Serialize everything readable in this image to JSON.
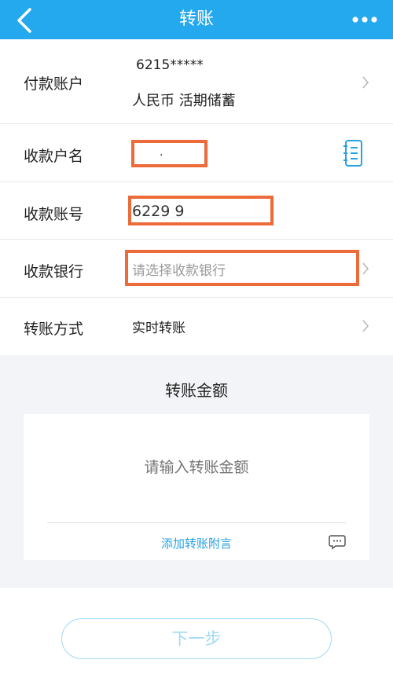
{
  "header": {
    "title": "转账",
    "back_icon": "back-chevron-icon",
    "more_icon": "more-dots-icon",
    "bg_color": "#24a8ee"
  },
  "form": {
    "payer": {
      "label": "付款账户",
      "account_number": "6215*****",
      "account_type": "人民币 活期储蓄"
    },
    "payee_name": {
      "label": "收款户名",
      "value": ".",
      "contacts_icon": "address-book-icon"
    },
    "payee_account": {
      "label": "收款账号",
      "value": "6229 9"
    },
    "payee_bank": {
      "label": "收款银行",
      "placeholder": "请选择收款银行"
    },
    "transfer_method": {
      "label": "转账方式",
      "value": "实时转账"
    }
  },
  "amount": {
    "title": "转账金额",
    "placeholder": "请输入转账金额",
    "add_note": "添加转账附言",
    "note_icon": "message-bubble-icon"
  },
  "footer": {
    "next_label": "下一步"
  },
  "colors": {
    "highlight": "#ec6b38",
    "link": "#27a2e2",
    "disabled_button": "#9fd9f5"
  }
}
